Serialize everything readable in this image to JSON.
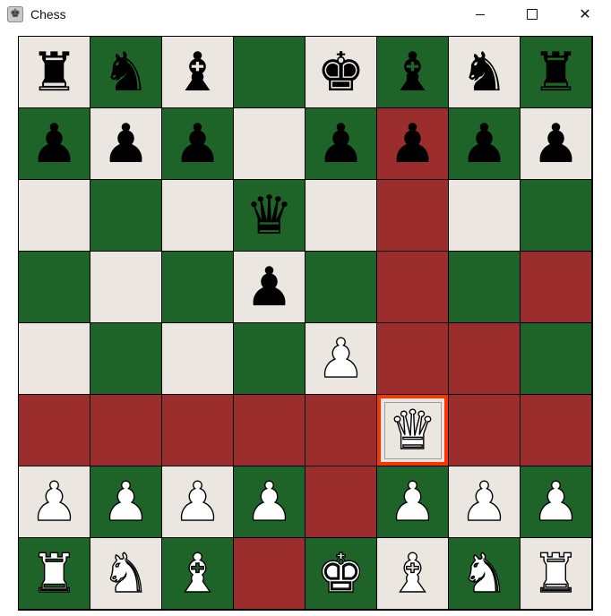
{
  "window": {
    "title": "Chess",
    "app_icon": "chess-app-icon",
    "controls": [
      "minimize-icon",
      "maximize-icon",
      "close-icon"
    ]
  },
  "colors": {
    "light_square": "#ebe6e0",
    "dark_square": "#1e6328",
    "highlight_square": "#9b2d2d",
    "selected_border": "#ff3300"
  },
  "board": {
    "selected": "f3",
    "highlighted_squares": [
      "f7",
      "f6",
      "f5",
      "f4",
      "g4",
      "h5",
      "a3",
      "b3",
      "c3",
      "d3",
      "e3",
      "g3",
      "h3",
      "e2",
      "d1"
    ],
    "ranks": [
      [
        "bR",
        "bN",
        "bB",
        "",
        "bK",
        "bB",
        "bN",
        "bR"
      ],
      [
        "bP",
        "bP",
        "bP",
        "",
        "bP",
        "bP",
        "bP",
        "bP"
      ],
      [
        "",
        "",
        "",
        "bQ",
        "",
        "",
        "",
        ""
      ],
      [
        "",
        "",
        "",
        "bP",
        "",
        "",
        "",
        ""
      ],
      [
        "",
        "",
        "",
        "",
        "wP",
        "",
        "",
        ""
      ],
      [
        "",
        "",
        "",
        "",
        "",
        "wQ",
        "",
        ""
      ],
      [
        "wP",
        "wP",
        "wP",
        "wP",
        "",
        "wP",
        "wP",
        "wP"
      ],
      [
        "wR",
        "wN",
        "wB",
        "",
        "wK",
        "wB",
        "wN",
        "wR"
      ]
    ]
  }
}
